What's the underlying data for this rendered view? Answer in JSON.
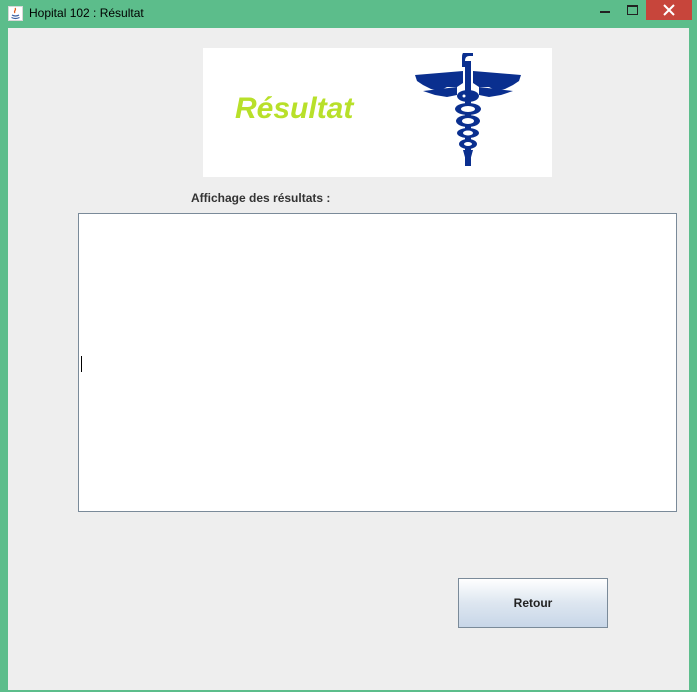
{
  "window": {
    "title": "Hopital 102 : Résultat",
    "controls": [
      "minimize",
      "maximize",
      "close"
    ]
  },
  "banner": {
    "title": "Résultat",
    "title_color": "#b8e02a",
    "logo_icon": "caduceus-icon",
    "logo_color": "#0a2f8f"
  },
  "results": {
    "label": "Affichage des résultats :",
    "value": ""
  },
  "buttons": {
    "retour": "Retour"
  }
}
